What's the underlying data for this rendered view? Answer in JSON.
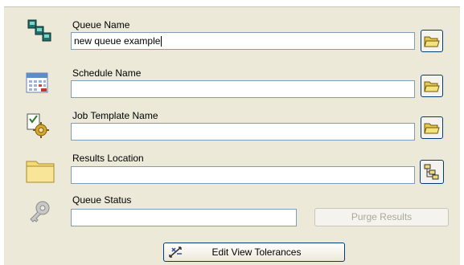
{
  "form": {
    "queue_name": {
      "label": "Queue Name",
      "value": "new queue example"
    },
    "schedule_name": {
      "label": "Schedule Name",
      "value": ""
    },
    "job_template_name": {
      "label": "Job Template Name",
      "value": ""
    },
    "results_location": {
      "label": "Results Location",
      "value": ""
    },
    "queue_status": {
      "label": "Queue Status",
      "value": ""
    }
  },
  "buttons": {
    "purge_results": "Purge Results",
    "edit_view_tolerances": "Edit View Tolerances"
  },
  "icons": {
    "queue": "queue-icon",
    "schedule": "calendar-icon",
    "job_template": "job-template-icon",
    "results_location": "folder-icon",
    "queue_status": "status-key-icon",
    "browse": "open-folder-icon",
    "tree_browse": "tree-icon",
    "tolerances": "tolerances-icon"
  }
}
